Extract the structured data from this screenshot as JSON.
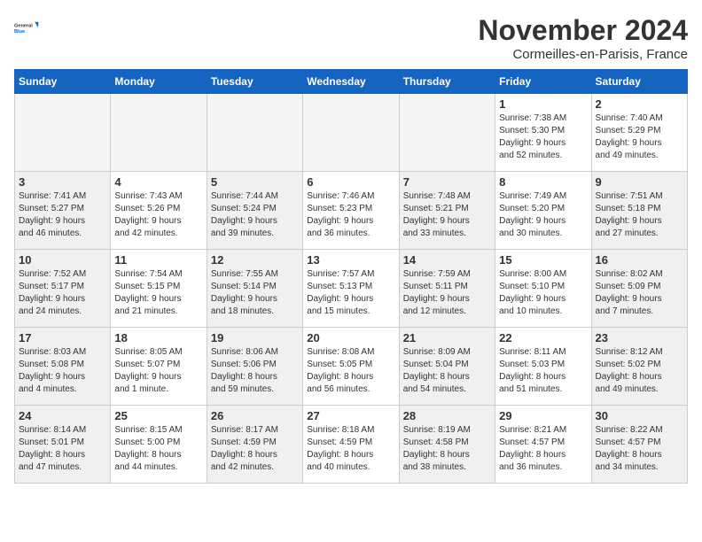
{
  "logo": {
    "line1": "General",
    "line2": "Blue"
  },
  "title": "November 2024",
  "location": "Cormeilles-en-Parisis, France",
  "headers": [
    "Sunday",
    "Monday",
    "Tuesday",
    "Wednesday",
    "Thursday",
    "Friday",
    "Saturday"
  ],
  "rows": [
    [
      {
        "day": "",
        "empty": true
      },
      {
        "day": "",
        "empty": true
      },
      {
        "day": "",
        "empty": true
      },
      {
        "day": "",
        "empty": true
      },
      {
        "day": "",
        "empty": true
      },
      {
        "day": "1",
        "info": "Sunrise: 7:38 AM\nSunset: 5:30 PM\nDaylight: 9 hours\nand 52 minutes."
      },
      {
        "day": "2",
        "info": "Sunrise: 7:40 AM\nSunset: 5:29 PM\nDaylight: 9 hours\nand 49 minutes."
      }
    ],
    [
      {
        "day": "3",
        "info": "Sunrise: 7:41 AM\nSunset: 5:27 PM\nDaylight: 9 hours\nand 46 minutes.",
        "shaded": true
      },
      {
        "day": "4",
        "info": "Sunrise: 7:43 AM\nSunset: 5:26 PM\nDaylight: 9 hours\nand 42 minutes."
      },
      {
        "day": "5",
        "info": "Sunrise: 7:44 AM\nSunset: 5:24 PM\nDaylight: 9 hours\nand 39 minutes.",
        "shaded": true
      },
      {
        "day": "6",
        "info": "Sunrise: 7:46 AM\nSunset: 5:23 PM\nDaylight: 9 hours\nand 36 minutes."
      },
      {
        "day": "7",
        "info": "Sunrise: 7:48 AM\nSunset: 5:21 PM\nDaylight: 9 hours\nand 33 minutes.",
        "shaded": true
      },
      {
        "day": "8",
        "info": "Sunrise: 7:49 AM\nSunset: 5:20 PM\nDaylight: 9 hours\nand 30 minutes."
      },
      {
        "day": "9",
        "info": "Sunrise: 7:51 AM\nSunset: 5:18 PM\nDaylight: 9 hours\nand 27 minutes.",
        "shaded": true
      }
    ],
    [
      {
        "day": "10",
        "info": "Sunrise: 7:52 AM\nSunset: 5:17 PM\nDaylight: 9 hours\nand 24 minutes.",
        "shaded": true
      },
      {
        "day": "11",
        "info": "Sunrise: 7:54 AM\nSunset: 5:15 PM\nDaylight: 9 hours\nand 21 minutes."
      },
      {
        "day": "12",
        "info": "Sunrise: 7:55 AM\nSunset: 5:14 PM\nDaylight: 9 hours\nand 18 minutes.",
        "shaded": true
      },
      {
        "day": "13",
        "info": "Sunrise: 7:57 AM\nSunset: 5:13 PM\nDaylight: 9 hours\nand 15 minutes."
      },
      {
        "day": "14",
        "info": "Sunrise: 7:59 AM\nSunset: 5:11 PM\nDaylight: 9 hours\nand 12 minutes.",
        "shaded": true
      },
      {
        "day": "15",
        "info": "Sunrise: 8:00 AM\nSunset: 5:10 PM\nDaylight: 9 hours\nand 10 minutes."
      },
      {
        "day": "16",
        "info": "Sunrise: 8:02 AM\nSunset: 5:09 PM\nDaylight: 9 hours\nand 7 minutes.",
        "shaded": true
      }
    ],
    [
      {
        "day": "17",
        "info": "Sunrise: 8:03 AM\nSunset: 5:08 PM\nDaylight: 9 hours\nand 4 minutes.",
        "shaded": true
      },
      {
        "day": "18",
        "info": "Sunrise: 8:05 AM\nSunset: 5:07 PM\nDaylight: 9 hours\nand 1 minute."
      },
      {
        "day": "19",
        "info": "Sunrise: 8:06 AM\nSunset: 5:06 PM\nDaylight: 8 hours\nand 59 minutes.",
        "shaded": true
      },
      {
        "day": "20",
        "info": "Sunrise: 8:08 AM\nSunset: 5:05 PM\nDaylight: 8 hours\nand 56 minutes."
      },
      {
        "day": "21",
        "info": "Sunrise: 8:09 AM\nSunset: 5:04 PM\nDaylight: 8 hours\nand 54 minutes.",
        "shaded": true
      },
      {
        "day": "22",
        "info": "Sunrise: 8:11 AM\nSunset: 5:03 PM\nDaylight: 8 hours\nand 51 minutes."
      },
      {
        "day": "23",
        "info": "Sunrise: 8:12 AM\nSunset: 5:02 PM\nDaylight: 8 hours\nand 49 minutes.",
        "shaded": true
      }
    ],
    [
      {
        "day": "24",
        "info": "Sunrise: 8:14 AM\nSunset: 5:01 PM\nDaylight: 8 hours\nand 47 minutes.",
        "shaded": true
      },
      {
        "day": "25",
        "info": "Sunrise: 8:15 AM\nSunset: 5:00 PM\nDaylight: 8 hours\nand 44 minutes."
      },
      {
        "day": "26",
        "info": "Sunrise: 8:17 AM\nSunset: 4:59 PM\nDaylight: 8 hours\nand 42 minutes.",
        "shaded": true
      },
      {
        "day": "27",
        "info": "Sunrise: 8:18 AM\nSunset: 4:59 PM\nDaylight: 8 hours\nand 40 minutes."
      },
      {
        "day": "28",
        "info": "Sunrise: 8:19 AM\nSunset: 4:58 PM\nDaylight: 8 hours\nand 38 minutes.",
        "shaded": true
      },
      {
        "day": "29",
        "info": "Sunrise: 8:21 AM\nSunset: 4:57 PM\nDaylight: 8 hours\nand 36 minutes."
      },
      {
        "day": "30",
        "info": "Sunrise: 8:22 AM\nSunset: 4:57 PM\nDaylight: 8 hours\nand 34 minutes.",
        "shaded": true
      }
    ]
  ]
}
